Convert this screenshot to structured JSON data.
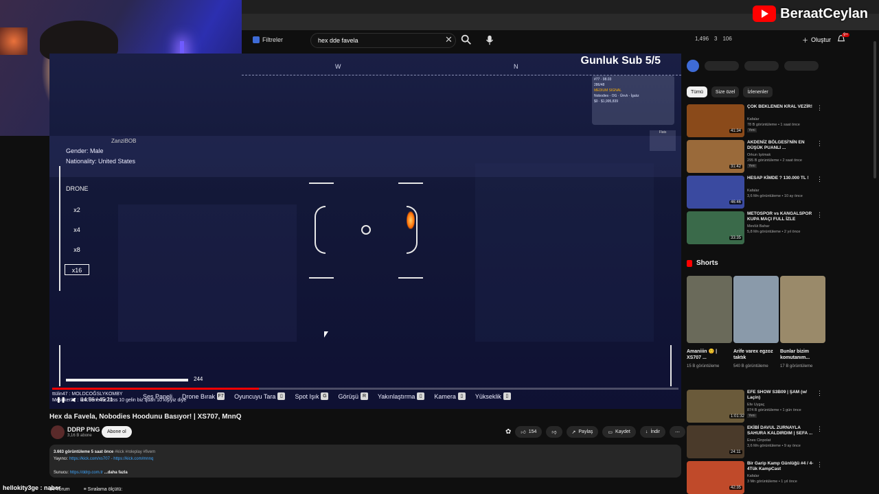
{
  "streamer": {
    "name": "BeraatCeylan"
  },
  "topbar": {
    "filters_label": "Filtreler",
    "search_value": "hex dde favela",
    "stats": [
      "1,496",
      "3",
      "106"
    ],
    "create_label": "Oluştur",
    "notif_count": "9+"
  },
  "hud": {
    "title": "Gunluk Sub 5/5",
    "compass": [
      "W",
      "N"
    ],
    "gender": "Gender: Male",
    "nationality": "Nationality: United States",
    "callsign": "ZanziBOB",
    "zoom_label": "DRONE",
    "zoom_levels": [
      "x2",
      "x4",
      "x8",
      "x16"
    ],
    "battery_value": "244",
    "panel": {
      "id": "#77",
      "count": "286/48",
      "ping": "98.03",
      "job_label": "Nobodies - OG",
      "status": "Ünvlı - İgalız",
      "money_label": "$0",
      "money_value": "$1,995,839",
      "signal": "MEDIUM SIGNAL"
    },
    "flag_label": "Flats",
    "keys": [
      {
        "label": "Ses Paneli",
        "key": ""
      },
      {
        "label": "Drone Bırak",
        "key": "F7"
      },
      {
        "label": "Oyuncuyu Tara",
        "key": ""
      },
      {
        "label": "Spot Işık",
        "key": "G"
      },
      {
        "label": "Görüşü",
        "key": "R"
      },
      {
        "label": "Yakınlaştırma",
        "key": ""
      },
      {
        "label": "Kamera",
        "key": ""
      },
      {
        "label": "Yükseklik",
        "key": ""
      }
    ],
    "time": "14:56 / 45:21",
    "chat_line1": "ttülin47 : MOLDCOĞSLYKOMBY",
    "chat_line2": "Mesuker27 : knk deneme 10ss 10 gelin biz quan 10 kişiyiz diye"
  },
  "video": {
    "title": "Hex da Favela, Nobodies Hoodunu Basıyor! | XS707, MnnQ",
    "channel": "DDRP PNG",
    "subs": "3,16 B abone",
    "subscribe": "Abone ol",
    "likes": "154",
    "share": "Paylaş",
    "save": "Kaydet",
    "download": "İndir",
    "desc_stats": "3.663 görüntüleme  5 saat önce",
    "desc_tags": "#kick #roleplay #fivem",
    "desc_streamers_label": "Yayıncı:",
    "desc_streamers_links": "https://kick.com/xs707 - https://kick.com/mnnq",
    "desc_server_label": "Sunucu:",
    "desc_server_link": "https://ddrp.com.tr",
    "desc_more": "...daha fazla",
    "comments": "84 Yorum",
    "sort": "Sıralama ölçütü:"
  },
  "chat_bottom": "hellokity3ge : naber",
  "sidebar": {
    "chips": [
      "Tümü",
      "Size özel",
      "İzlenenler"
    ],
    "recs": [
      {
        "title": "ÇOK BEKLENEN KRAL VEZİR!",
        "channel": "Kafalar",
        "meta": "78 B görüntüleme • 1 saat önce",
        "badge": "Yeni",
        "dur": "41:34",
        "color": "#8a4a1a"
      },
      {
        "title": "AKDENİZ BÖLGESİ'NİN EN DÜŞÜK PUANLI ...",
        "channel": "Orkun Işıtmak",
        "meta": "295 B görüntüleme • 2 saat önce",
        "badge": "Yeni",
        "dur": "31:42",
        "color": "#9a6a3a"
      },
      {
        "title": "HESAP KİMDE ? 130.000 TL !",
        "channel": "Kafalar",
        "meta": "3,6 Mn görüntüleme • 10 ay önce",
        "badge": "",
        "dur": "46:46",
        "color": "#3a4aa0"
      },
      {
        "title": "METOSPOR vs KANGALSPOR KUPA MAÇI FULL İZLE",
        "channel": "Mevlüt Bahar",
        "meta": "5,8 Mn görüntüleme • 2 yıl önce",
        "badge": "",
        "dur": "33:35",
        "color": "#3a6a4a"
      }
    ],
    "shorts_title": "Shorts",
    "shorts": [
      {
        "title": "Amaniiin 😊 | XS707 ...",
        "views": "15 B görüntüleme",
        "color": "#6a6a5a"
      },
      {
        "title": "Arife varex egzoz taktık",
        "views": "540 B görüntüleme",
        "color": "#8a9aaa"
      },
      {
        "title": "Bunlar bizim komutanım...",
        "views": "17 B görüntüleme",
        "color": "#9a8a6a"
      }
    ],
    "recs2": [
      {
        "title": "EFE SHOW S3B09 | ŞAM (w/ Laçin)",
        "channel": "Efe Uygaç",
        "meta": "874 B görüntüleme • 1 gün önce",
        "badge": "Yeni",
        "dur": "1:01:32",
        "color": "#6a5a3a"
      },
      {
        "title": "EKİBİ DAVUL ZURNAYLA SAHURA KALDIRDIM | SEFA ...",
        "channel": "Enes Cinpolat",
        "meta": "3,6 Mn görüntüleme • 9 ay önce",
        "badge": "",
        "dur": "24:11",
        "color": "#4a3a2a"
      },
      {
        "title": "Bir Garip Kamp Günlüğü #4 / 4-4Tük KampCast",
        "channel": "Kafalar",
        "meta": "3 Mn görüntüleme • 1 yıl önce",
        "badge": "",
        "dur": "42:35",
        "color": "#c04a2a"
      }
    ]
  }
}
